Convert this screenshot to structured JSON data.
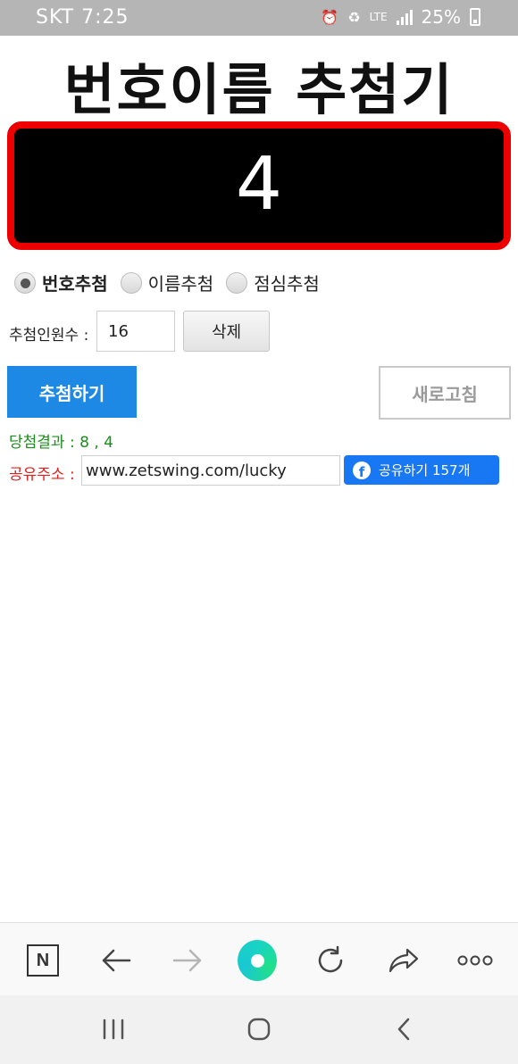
{
  "status_bar": {
    "carrier": "SKT",
    "time": "7:25",
    "network": "LTE",
    "battery": "25%"
  },
  "page": {
    "title": "번호이름 추첨기",
    "display_number": "4"
  },
  "draw_mode": {
    "options": [
      {
        "label": "번호추첨",
        "selected": true
      },
      {
        "label": "이름추첨",
        "selected": false
      },
      {
        "label": "점심추첨",
        "selected": false
      }
    ]
  },
  "count": {
    "label": "추첨인원수 :",
    "value": "16",
    "delete_label": "삭제"
  },
  "actions": {
    "draw_label": "추첨하기",
    "refresh_label": "새로고침"
  },
  "result": {
    "text": "당첨결과 : 8 , 4"
  },
  "share": {
    "label": "공유주소 :",
    "url": "www.zetswing.com/lucky",
    "button_label": "공유하기 157개"
  },
  "browser_toolbar": {
    "icons": [
      "naver-n-icon",
      "back-arrow-icon",
      "forward-arrow-icon",
      "home-icon",
      "reload-icon",
      "share-icon",
      "more-icon"
    ]
  },
  "system_nav": {
    "icons": [
      "recent-apps-icon",
      "home-nav-icon",
      "back-nav-icon"
    ]
  },
  "colors": {
    "display_border": "#ee0000",
    "draw_button": "#1e88e5",
    "result_text": "#1a8f1a",
    "share_label": "#e02020",
    "facebook": "#1877f2"
  }
}
